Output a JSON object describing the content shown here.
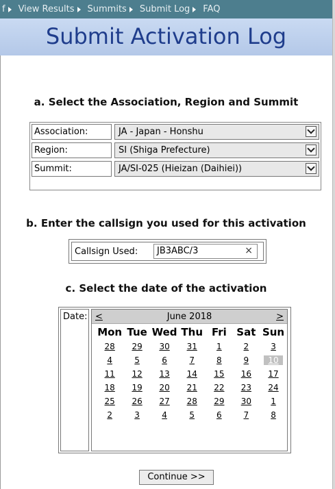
{
  "nav": {
    "items": [
      {
        "label": "f"
      },
      {
        "label": "View Results"
      },
      {
        "label": "Summits"
      },
      {
        "label": "Submit Log"
      },
      {
        "label": "FAQ"
      }
    ]
  },
  "page": {
    "title": "Submit Activation Log"
  },
  "section_a": {
    "heading": "a. Select the Association, Region and Summit",
    "association": {
      "label": "Association:",
      "value": "JA - Japan - Honshu"
    },
    "region": {
      "label": "Region:",
      "value": "SI (Shiga Prefecture)"
    },
    "summit": {
      "label": "Summit:",
      "value": "JA/SI-025 (Hieizan (Daihiei))"
    }
  },
  "section_b": {
    "heading": "b. Enter the callsign you used for this activation",
    "callsign": {
      "label": "Callsign Used:",
      "value": "JB3ABC/3",
      "clear": "×"
    }
  },
  "section_c": {
    "heading": "c. Select the date of the activation",
    "date_label": "Date:",
    "calendar": {
      "prev": "<",
      "next": ">",
      "month": "June 2018",
      "weekdays": [
        "Mon",
        "Tue",
        "Wed",
        "Thu",
        "Fri",
        "Sat",
        "Sun"
      ],
      "weeks": [
        [
          "28",
          "29",
          "30",
          "31",
          "1",
          "2",
          "3"
        ],
        [
          "4",
          "5",
          "6",
          "7",
          "8",
          "9",
          "10"
        ],
        [
          "11",
          "12",
          "13",
          "14",
          "15",
          "16",
          "17"
        ],
        [
          "18",
          "19",
          "20",
          "21",
          "22",
          "23",
          "24"
        ],
        [
          "25",
          "26",
          "27",
          "28",
          "29",
          "30",
          "1"
        ],
        [
          "2",
          "3",
          "4",
          "5",
          "6",
          "7",
          "8"
        ]
      ],
      "selected": "10"
    }
  },
  "actions": {
    "continue_label": "Continue >>"
  },
  "colors": {
    "nav_bg": "#4d7e8e",
    "title_color": "#1f3d8c",
    "title_band": "#c0d3ee"
  }
}
